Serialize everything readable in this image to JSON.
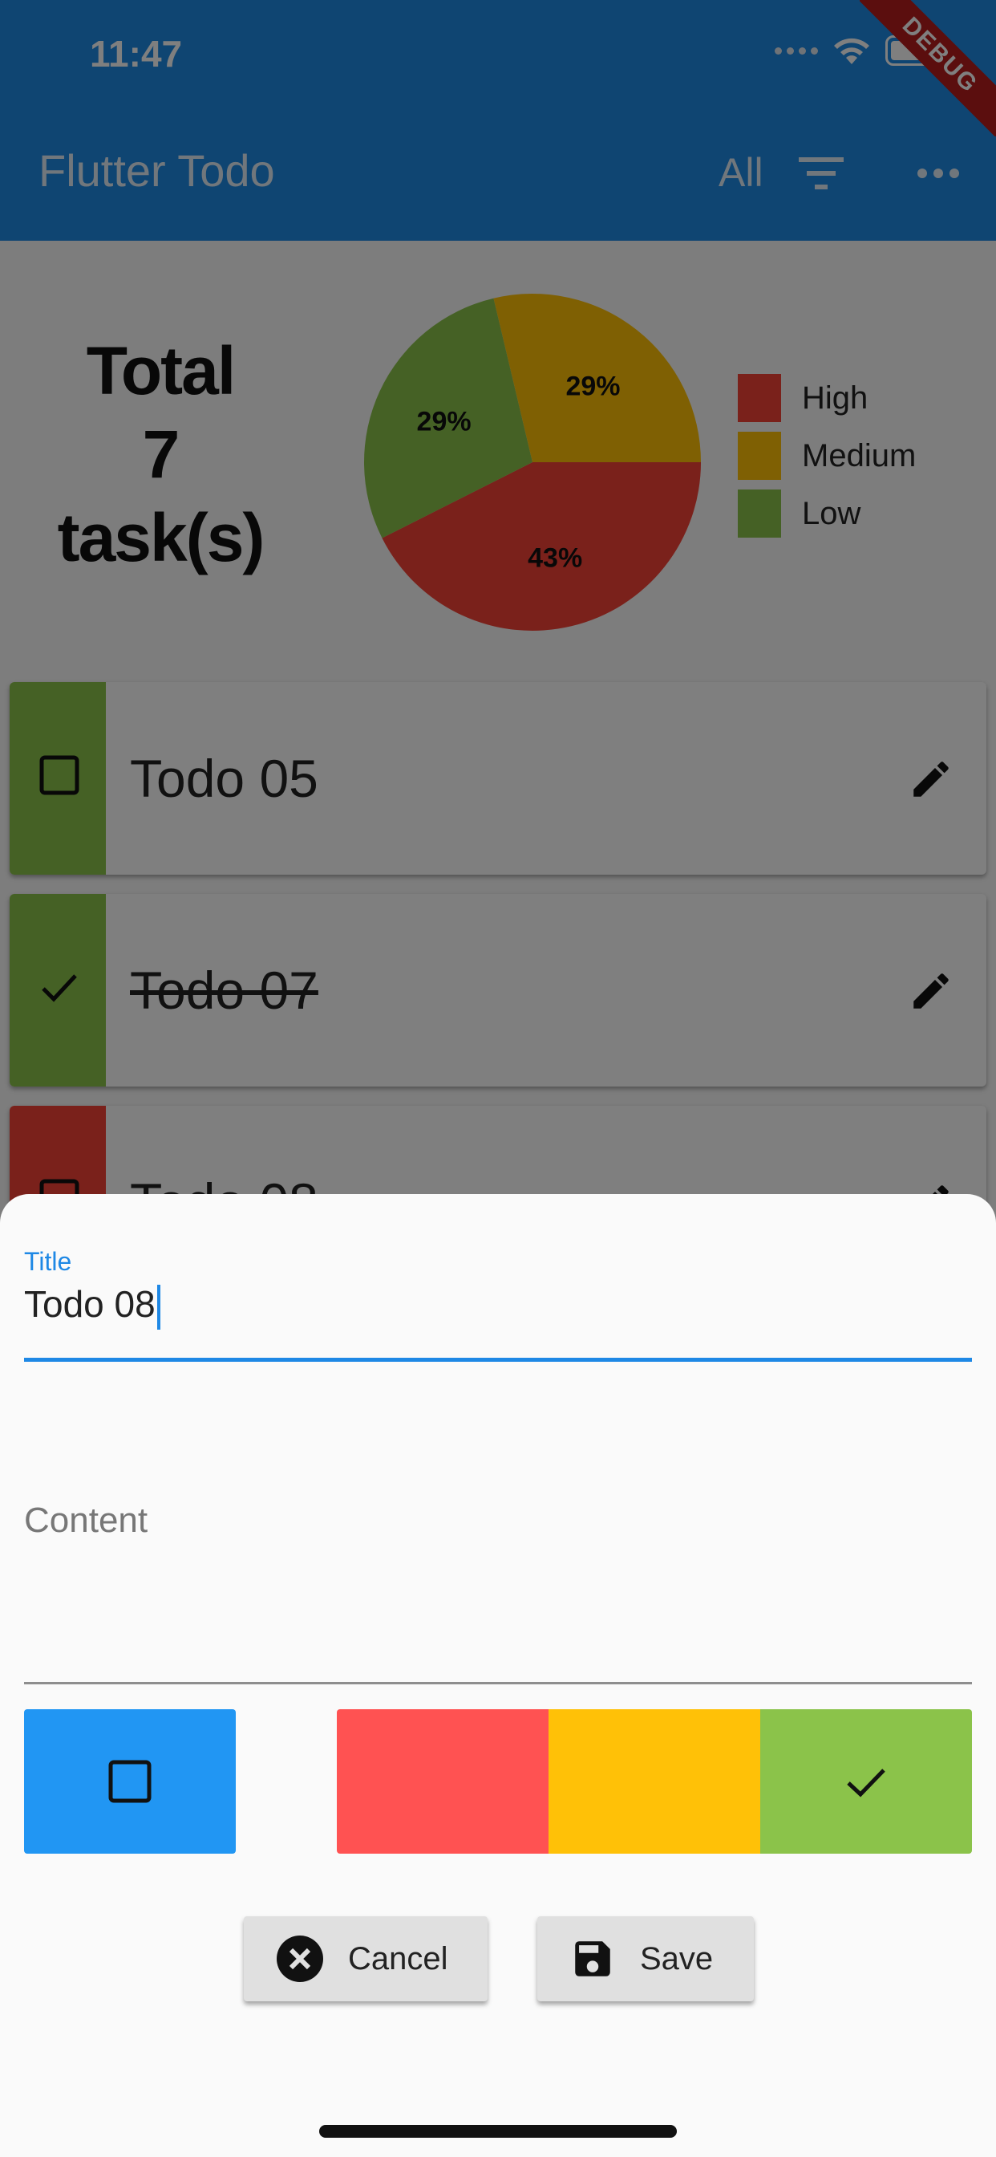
{
  "status_bar": {
    "time": "11:47"
  },
  "app_bar": {
    "title": "Flutter Todo",
    "filter_label": "All",
    "filter_icon": "filter-list-icon",
    "more_icon": "more-horizontal-icon",
    "debug_banner": "DEBUG"
  },
  "summary": {
    "line1": "Total",
    "count": "7",
    "line3": "task(s)"
  },
  "chart_data": {
    "type": "pie",
    "title": "",
    "slices": [
      {
        "name": "High",
        "value": 43,
        "label": "43%",
        "color": "#f44336"
      },
      {
        "name": "Low",
        "value": 29,
        "label": "29%",
        "color": "#8bc34a"
      },
      {
        "name": "Medium",
        "value": 29,
        "label": "29%",
        "color": "#ffc107"
      }
    ],
    "legend": [
      "High",
      "Medium",
      "Low"
    ],
    "legend_placement": "right"
  },
  "todos": [
    {
      "title": "Todo 05",
      "done": false,
      "priority": "Low",
      "color": "#8bc34a"
    },
    {
      "title": "Todo 07",
      "done": true,
      "priority": "Low",
      "color": "#8bc34a"
    },
    {
      "title": "Todo 08",
      "done": false,
      "priority": "High",
      "color": "#f44336"
    }
  ],
  "editor": {
    "title_label": "Title",
    "title_value": "Todo 08",
    "content_placeholder": "Content",
    "priority_options": [
      "High",
      "Medium",
      "Low"
    ],
    "selected_priority": "Low",
    "done_checked": false,
    "cancel_label": "Cancel",
    "save_label": "Save",
    "cancel_icon": "cancel-circle-icon",
    "save_icon": "save-floppy-icon",
    "colors": {
      "accent": "#1e88e5",
      "high": "#ff5252",
      "medium": "#ffc107",
      "low": "#8bc34a",
      "done_tile": "#2196f3"
    }
  }
}
